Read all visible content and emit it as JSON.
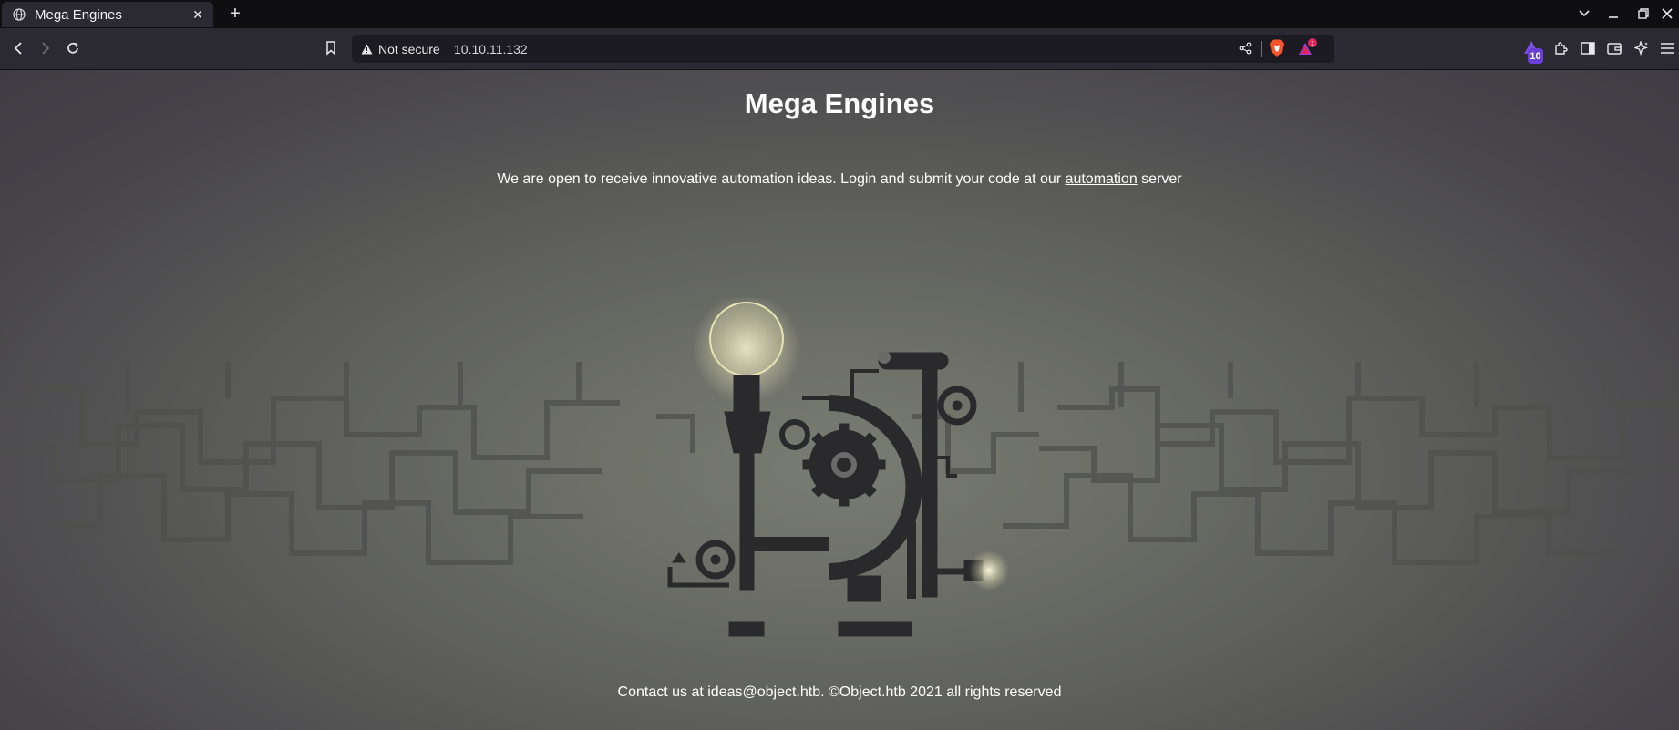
{
  "browser": {
    "tab": {
      "title": "Mega Engines",
      "favicon": "globe-icon"
    },
    "security_label": "Not secure",
    "url": "10.10.11.132",
    "alerts_count": "1",
    "rewards_count": "10"
  },
  "page": {
    "heading": "Mega Engines",
    "intro_before": "We are open to receive innovative automation ideas. Login and submit your code at our ",
    "intro_link": "automation",
    "intro_after": " server",
    "footer": "Contact us at ideas@object.htb. ©Object.htb 2021 all rights reserved"
  },
  "colors": {
    "page_bg": "#5f605c",
    "chrome_bg": "#2b2a33",
    "tabstrip_bg": "#0f0f12",
    "machine": "#2a2a2c",
    "bulb_glow": "#e9e6b8",
    "brave_orange": "#fb542b",
    "alert_red": "#e0245e"
  }
}
